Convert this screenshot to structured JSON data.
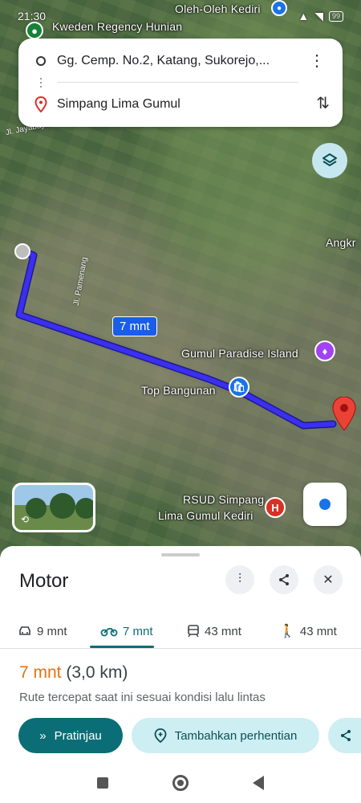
{
  "status_bar": {
    "time": "21:30",
    "battery": "99"
  },
  "map": {
    "labels": {
      "top_place": "Oleh-Oleh Kediri",
      "housing": "Kweden Regency Hunian",
      "angkr": "Angkr",
      "gumul_paradise": "Gumul Paradise Island",
      "top_bangunan": "Top Bangunan",
      "rsud_line1": "RSUD Simpang",
      "rsud_line2": "Lima Gumul Kediri",
      "road_pamenang": "Jl. Pamenang",
      "road_jayabaya": "Jl. Jayabaya Watwang"
    },
    "route_time": "7 mnt",
    "route_color": "#3b2ff0"
  },
  "search": {
    "origin": "Gg. Cemp. No.2, Katang, Sukorejo,...",
    "destination": "Simpang Lima Gumul"
  },
  "sheet": {
    "title": "Motor",
    "modes": [
      {
        "name": "car",
        "label": "9 mnt"
      },
      {
        "name": "motorcycle",
        "label": "7 mnt"
      },
      {
        "name": "transit",
        "label": "43 mnt"
      },
      {
        "name": "walk",
        "label": "43 mnt"
      }
    ],
    "result": {
      "time": "7 mnt",
      "distance": "(3,0 km)",
      "description": "Rute tercepat saat ini sesuai kondisi lalu lintas"
    },
    "buttons": {
      "preview": "Pratinjau",
      "add_stop": "Tambahkan perhentian"
    }
  },
  "colors": {
    "accent": "#0b6e76",
    "time_orange": "#e8710a",
    "route_blue": "#3b2ff0"
  }
}
